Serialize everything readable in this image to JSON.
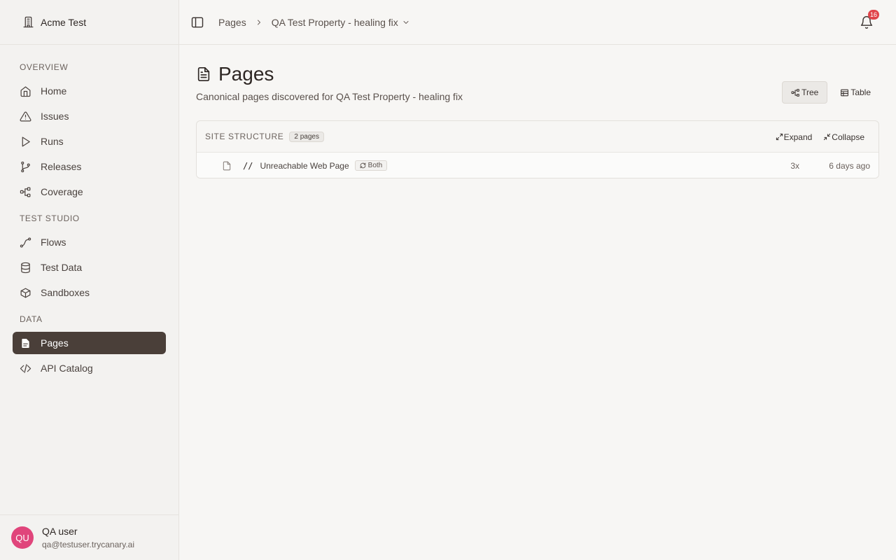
{
  "org": {
    "name": "Acme Test",
    "icon": "building-icon"
  },
  "sidebar": {
    "sections": [
      {
        "label": "OVERVIEW",
        "items": [
          {
            "label": "Home",
            "icon": "home-icon"
          },
          {
            "label": "Issues",
            "icon": "warning-icon"
          },
          {
            "label": "Runs",
            "icon": "play-icon"
          },
          {
            "label": "Releases",
            "icon": "git-branch-icon"
          },
          {
            "label": "Coverage",
            "icon": "network-icon"
          }
        ]
      },
      {
        "label": "TEST STUDIO",
        "items": [
          {
            "label": "Flows",
            "icon": "flow-icon"
          },
          {
            "label": "Test Data",
            "icon": "database-icon"
          },
          {
            "label": "Sandboxes",
            "icon": "box-icon"
          }
        ]
      },
      {
        "label": "DATA",
        "items": [
          {
            "label": "Pages",
            "icon": "file-icon",
            "active": true
          },
          {
            "label": "API Catalog",
            "icon": "code-icon"
          }
        ]
      }
    ]
  },
  "user": {
    "initials": "QU",
    "name": "QA user",
    "email": "qa@testuser.trycanary.ai",
    "avatar_color": "#e0457b"
  },
  "header": {
    "breadcrumb": [
      "Pages",
      "QA Test Property - healing fix"
    ],
    "notification_count": "16"
  },
  "page": {
    "title": "Pages",
    "subtitle": "Canonical pages discovered for QA Test Property - healing fix",
    "view_options": [
      {
        "label": "Tree",
        "icon": "tree-icon",
        "active": true
      },
      {
        "label": "Table",
        "icon": "table-icon",
        "active": false
      }
    ]
  },
  "site_structure": {
    "title": "SITE STRUCTURE",
    "count": "2 pages",
    "expand_label": "Expand",
    "collapse_label": "Collapse",
    "rows": [
      {
        "path": "//",
        "name": "Unreachable Web Page",
        "source": "Both",
        "visits": "3x",
        "last_seen": "6 days ago"
      }
    ]
  },
  "colors": {
    "active_nav": "#4a3f39",
    "badge": "#e0454b",
    "background": "#f7f6f4"
  }
}
